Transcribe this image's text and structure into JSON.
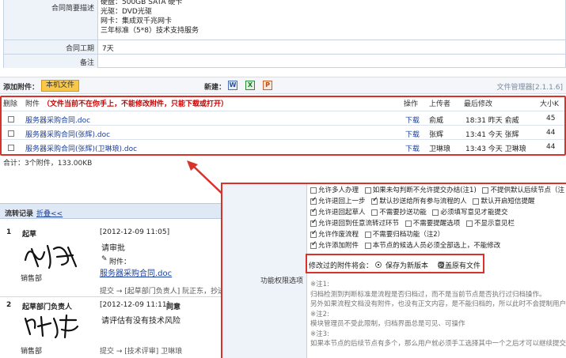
{
  "form": {
    "summary_label": "合同简要描述",
    "summary_lines": [
      "硬盘：500GB SATA 硬卡",
      "光驱：DVD光驱",
      "网卡：集成双千兆网卡",
      "三年标准（5*8）技术支持服务"
    ],
    "period_label": "合同工期",
    "period_value": "7天",
    "remark_label": "备注"
  },
  "toolbar": {
    "add_attachment_label": "添加附件：",
    "local_file_button": "本机文件",
    "new_label": "新建：",
    "file_manager": "文件管理器[2.1.1.6]"
  },
  "attachments": {
    "header": {
      "delete": "删除",
      "attachment": "附件",
      "warning": "（文件当前不在你手上，不能修改附件，只能下载或打开）",
      "action": "操作",
      "uploader": "上传者",
      "last_modified": "最后修改",
      "size": "大小K"
    },
    "rows": [
      {
        "name": "服务器采购合同.doc",
        "action": "下载",
        "uploader": "俞威",
        "modified": "18:31 昨天 俞威",
        "size": "45"
      },
      {
        "name": "服务器采购合同(张辉).doc",
        "action": "下载",
        "uploader": "张辉",
        "modified": "13:41 今天 张辉",
        "size": "44"
      },
      {
        "name": "服务器采购合同(张辉)(卫琳琅).doc",
        "action": "下载",
        "uploader": "卫琳琅",
        "modified": "13:43 今天 卫琳琅",
        "size": "44"
      }
    ],
    "total": "合计：3个附件，133.00KB"
  },
  "flow": {
    "title": "流转记录",
    "collapse_link": "折叠<<",
    "entries": [
      {
        "index": "1",
        "role": "起草",
        "dept": "销售部",
        "time": "[2012-12-09 11:05]",
        "comment": "请审批",
        "attach_label": "附件：",
        "attach_link": "服务器采购合同.doc",
        "submit": "提交 → [起草部门负责人] 阮正东，抄送："
      },
      {
        "index": "2",
        "role": "起草部门负责人",
        "dept": "销售部",
        "time": "[2012-12-09 11:11]",
        "status": "同意",
        "comment": "请评估有没有技术风险",
        "submit": "提交 → [技术评审] 卫琳琅"
      }
    ]
  },
  "options": {
    "section_label": "功能权限选项",
    "rows": [
      [
        {
          "label": "允许多人办理",
          "on": false
        },
        {
          "label": "如果未勾判断不允许提交办结(注1)",
          "on": false
        },
        {
          "label": "不提供默认后续节点（注",
          "on": false
        }
      ],
      [
        {
          "label": "允许退回上一步",
          "on": true
        },
        {
          "label": "默认抄送给所有参与流程的人",
          "on": true
        },
        {
          "label": "默认开启短信提醒",
          "on": false
        }
      ],
      [
        {
          "label": "允许退回起草人",
          "on": true
        },
        {
          "label": "不需要抄送功能",
          "on": false
        },
        {
          "label": "必须填写意见才能提交",
          "on": false
        }
      ],
      [
        {
          "label": "允许退回到任意流转过环节",
          "on": true
        },
        {
          "label": "不需要提醒选项",
          "on": false
        },
        {
          "label": "不显示意见栏",
          "on": false
        }
      ],
      [
        {
          "label": "允许作废流程",
          "on": true
        },
        {
          "label": "不需要归档功能（注2）",
          "on": false
        }
      ],
      [
        {
          "label": "允许添加附件",
          "on": true
        },
        {
          "label": "本节点的候选人员必须全部选上，不能修改",
          "on": false
        }
      ]
    ],
    "modify_label": "修改过的附件将会：",
    "save_new": "保存为新版本",
    "overwrite": "覆盖原有文件",
    "notes": [
      "※注1:",
      "归档检测到判断标准是流程是否归档过，而不是当前节点是否执行过归档操作。",
      "另外如果流程文档没有附件，也没有正文内容，是不能归档的，所以此时不会提制用户",
      "※注2:",
      "模块管理员不受此限制，归档界面总是可见、可操作",
      "※注3:",
      "如果本节点的后续节点有多个，那么用户就必须手工选择其中一个之后才可以继续提交"
    ]
  },
  "colors": {
    "accent_red": "#cc0000",
    "link_blue": "#1a3f9c",
    "label_bg": "#eef3fa",
    "button_bg": "#f9c84a"
  }
}
